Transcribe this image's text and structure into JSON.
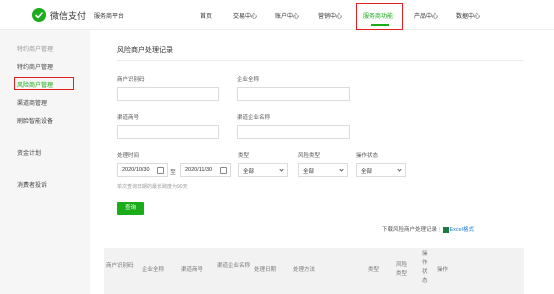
{
  "header": {
    "brand": "微信支付",
    "platform": "服务商平台",
    "nav": [
      "首页",
      "交易中心",
      "账户中心",
      "营销中心",
      "服务商功能",
      "产品中心",
      "数据中心"
    ]
  },
  "sidebar": {
    "items": [
      {
        "label": "特约商户管理",
        "group": true
      },
      {
        "label": "特约商户管理"
      },
      {
        "label": "风险商户管理",
        "active": true
      },
      {
        "label": "渠道商管理"
      },
      {
        "label": "刷脸智能设备"
      },
      {
        "label": "资金计划",
        "group": true
      },
      {
        "label": "消费者投诉",
        "group": true
      }
    ]
  },
  "main": {
    "title": "风险商户处理记录",
    "fields": {
      "merchant_id_label": "商户识别码",
      "company_name_label": "企业全称",
      "channel_id_label": "渠道商号",
      "channel_company_label": "渠道企业名称",
      "process_time_label": "处理时间",
      "date_from": "2020/10/30",
      "date_sep": "至",
      "date_to": "2020/11/30",
      "type_label": "类型",
      "type_value": "全部",
      "risk_type_label": "风险类型",
      "risk_type_value": "全部",
      "op_status_label": "操作状态",
      "op_status_value": "全部",
      "hint": "单次查询日期的最长跨度为90天"
    },
    "query_button": "查询",
    "download": {
      "text": "下载风险商户处理记录",
      "sep": "|",
      "excel": "Excel格式"
    },
    "table_headers": [
      "商户识别码",
      "企业全称",
      "渠道商号",
      "渠道企业名称",
      "处理日期",
      "处理方法",
      "类型",
      "风险类型",
      "操作状态",
      "操作"
    ]
  },
  "colors": {
    "accent": "#1aad19",
    "highlight": "#e02020"
  }
}
